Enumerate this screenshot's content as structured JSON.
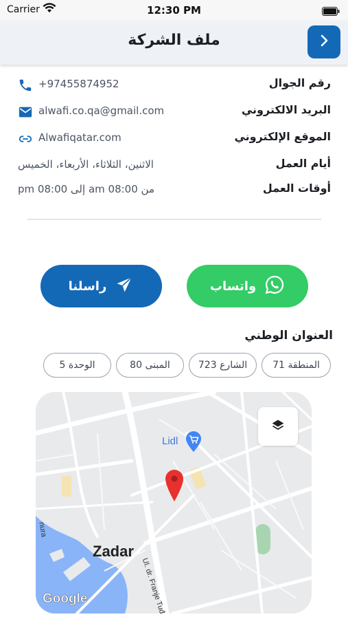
{
  "status_bar": {
    "carrier": "Carrier",
    "time": "12:30 PM"
  },
  "header": {
    "title": "ملف الشركة",
    "back_icon": "chevron-right-icon"
  },
  "info": {
    "phone": {
      "label": "رقم الجوال",
      "value": "+97455874952",
      "icon": "phone-icon"
    },
    "email": {
      "label": "البريد الالكتروني",
      "value": "alwafi.co.qa@gmail.com",
      "icon": "email-icon"
    },
    "website": {
      "label": "الموقع الإلكتروني",
      "value": "Alwafiqatar.com",
      "icon": "link-icon"
    },
    "work_days": {
      "label": "أيام العمل",
      "value": "الاثنين، الثلاثاء، الأربعاء، الخميس"
    },
    "work_hours": {
      "label": "أوقات العمل",
      "value": "من 08:00 am إلى 08:00 pm"
    }
  },
  "actions": {
    "whatsapp_label": "واتساب",
    "contact_label": "راسلنا"
  },
  "address": {
    "title": "العنوان الوطني",
    "chips": [
      "المنطقة 71",
      "الشارع 723",
      "المبنى 80",
      "الوحدة 5"
    ]
  },
  "map": {
    "labels": {
      "store": "Lidl",
      "city": "Zadar",
      "street": "Ul. dr. Franje Tuđmana",
      "street_partial": "nura",
      "provider": "Google"
    }
  },
  "colors": {
    "primary": "#1469b7",
    "whatsapp": "#33cc66",
    "pin": "#e8312f"
  }
}
